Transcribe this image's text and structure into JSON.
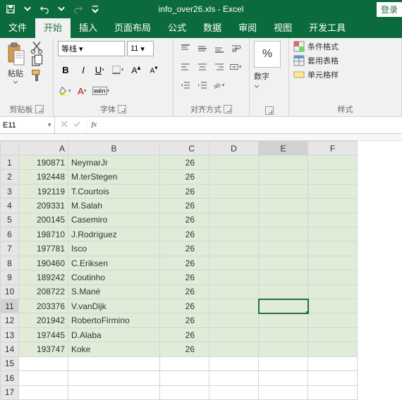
{
  "title": "info_over26.xls - Excel",
  "login_label": "登录",
  "tabs": {
    "file": "文件",
    "home": "开始",
    "insert": "插入",
    "pagelayout": "页面布局",
    "formulas": "公式",
    "data": "数据",
    "review": "审阅",
    "view": "视图",
    "developer": "开发工具"
  },
  "ribbon": {
    "clipboard": {
      "label": "剪贴板",
      "paste": "粘贴"
    },
    "font": {
      "label": "字体",
      "name": "等线",
      "size": "11"
    },
    "align": {
      "label": "对齐方式"
    },
    "number": {
      "label": "数字",
      "btn": "%"
    },
    "styles": {
      "label": "样式",
      "cond": "条件格式",
      "fmttable": "套用表格",
      "cellstyle": "单元格样"
    }
  },
  "namebox": "E11",
  "formula": "",
  "columns": [
    "A",
    "B",
    "C",
    "D",
    "E",
    "F"
  ],
  "selected_col": "E",
  "selected_row": 11,
  "rows": [
    {
      "a": "190871",
      "b": "NeymarJr",
      "c": "26"
    },
    {
      "a": "192448",
      "b": "M.terStegen",
      "c": "26"
    },
    {
      "a": "192119",
      "b": "T.Courtois",
      "c": "26"
    },
    {
      "a": "209331",
      "b": "M.Salah",
      "c": "26"
    },
    {
      "a": "200145",
      "b": "Casemiro",
      "c": "26"
    },
    {
      "a": "198710",
      "b": "J.Rodríguez",
      "c": "26"
    },
    {
      "a": "197781",
      "b": "Isco",
      "c": "26"
    },
    {
      "a": "190460",
      "b": "C.Eriksen",
      "c": "26"
    },
    {
      "a": "189242",
      "b": "Coutinho",
      "c": "26"
    },
    {
      "a": "208722",
      "b": "S.Mané",
      "c": "26"
    },
    {
      "a": "203376",
      "b": "V.vanDijk",
      "c": "26"
    },
    {
      "a": "201942",
      "b": "RobertoFirmino",
      "c": "26"
    },
    {
      "a": "197445",
      "b": "D.Alaba",
      "c": "26"
    },
    {
      "a": "193747",
      "b": "Koke",
      "c": "26"
    }
  ],
  "total_rows": 17
}
